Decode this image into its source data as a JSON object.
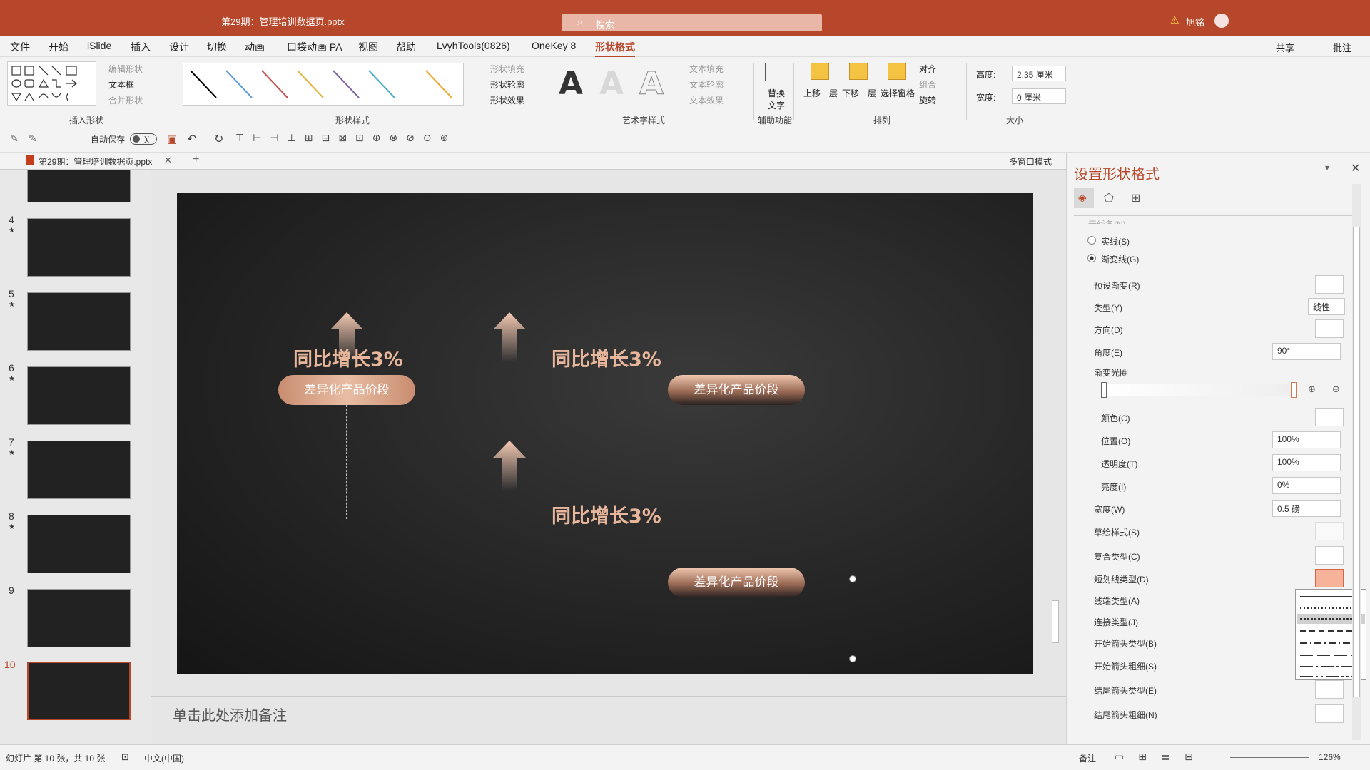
{
  "window": {
    "doc_title": "第29期：管理培训数据页.pptx",
    "user": "旭铭",
    "search_placeholder": "搜索"
  },
  "menu_tabs": [
    "文件",
    "开始",
    "iSlide",
    "插入",
    "设计",
    "切换",
    "动画",
    "口袋动画 PA",
    "视图",
    "帮助",
    "LvyhTools(0826)",
    "OneKey 8",
    "形状格式"
  ],
  "title_actions": {
    "share": "共享",
    "comment": "批注"
  },
  "ribbon": {
    "insert_shape": {
      "label": "插入形状",
      "edit_shape": "编辑形状",
      "text_box": "文本框",
      "merge_shape": "合并形状"
    },
    "shape_style": {
      "label": "形状样式",
      "fill": "形状填充",
      "outline": "形状轮廓",
      "effect": "形状效果"
    },
    "wordart": {
      "label": "艺术字样式",
      "text_fill": "文本填充",
      "text_outline": "文本轮廓",
      "text_effect": "文本效果",
      "glyph": "A"
    },
    "accessibility": {
      "label": "辅助功能",
      "alt_text": "替换文字"
    },
    "arrange": {
      "label": "排列",
      "bring_forward": "上移一层",
      "send_backward": "下移一层",
      "selection_pane": "选择窗格",
      "align": "对齐",
      "group": "组合",
      "rotate": "旋转"
    },
    "size": {
      "label": "大小",
      "height_label": "高度:",
      "height_value": "2.35 厘米",
      "width_label": "宽度:",
      "width_value": "0 厘米"
    }
  },
  "qat": {
    "autosave": "自动保存",
    "autosave_state": "关"
  },
  "doc_tab": {
    "name": "第29期：管理培训数据页.pptx",
    "multiwindow": "多窗口模式"
  },
  "thumbnails": [
    {
      "num": "4",
      "mark": "★"
    },
    {
      "num": "5",
      "mark": "★"
    },
    {
      "num": "6",
      "mark": "★"
    },
    {
      "num": "7",
      "mark": "★"
    },
    {
      "num": "8",
      "mark": "★"
    },
    {
      "num": "9",
      "mark": ""
    },
    {
      "num": "10",
      "mark": ""
    }
  ],
  "slide": {
    "headlines": [
      "同比增长3%",
      "同比增长3%",
      "同比增长3%"
    ],
    "pills": [
      "差异化产品价段",
      "差异化产品价段",
      "差异化产品价段"
    ]
  },
  "notes_placeholder": "单击此处添加备注",
  "panel": {
    "title": "设置形状格式",
    "line_cut": "无线条(N)",
    "solid_line": "实线(S)",
    "gradient_line": "渐变线(G)",
    "preset_gradient": "预设渐变(R)",
    "type_label": "类型(Y)",
    "type_value": "线性",
    "direction": "方向(D)",
    "angle_label": "角度(E)",
    "angle_value": "90°",
    "gradient_stops": "渐变光圈",
    "color": "颜色(C)",
    "position_label": "位置(O)",
    "position_value": "100%",
    "transparency_label": "透明度(T)",
    "transparency_value": "100%",
    "brightness_label": "亮度(I)",
    "brightness_value": "0%",
    "width_label": "宽度(W)",
    "width_value": "0.5 磅",
    "sketch_style": "草绘样式(S)",
    "compound_type": "复合类型(C)",
    "dash_type": "短划线类型(D)",
    "cap_type": "线端类型(A)",
    "join_type": "连接类型(J)",
    "begin_arrow_type": "开始箭头类型(B)",
    "begin_arrow_size": "开始箭头粗细(S)",
    "end_arrow_type": "结尾箭头类型(E)",
    "end_arrow_size": "结尾箭头粗细(N)"
  },
  "status": {
    "slide_info": "幻灯片 第 10 张，共 10 张",
    "language": "中文(中国)",
    "notes": "备注",
    "zoom": "126%"
  },
  "colors": {
    "accent": "#b7472a",
    "copper": "#e7b69b"
  }
}
